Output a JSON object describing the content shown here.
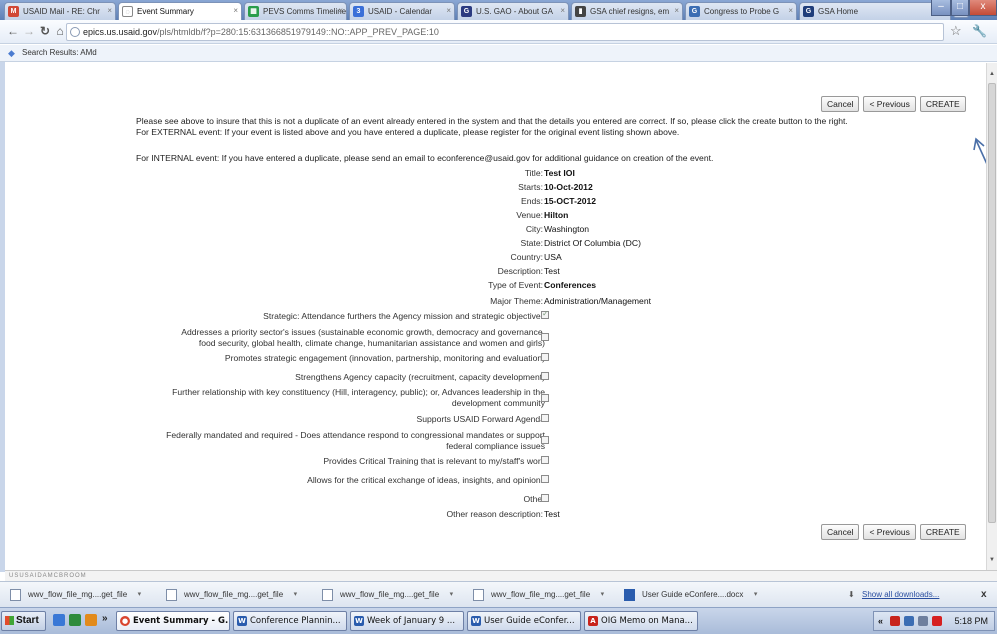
{
  "browser": {
    "tabs": [
      {
        "label": "USAID Mail - RE: Chr",
        "icon": "mail-icon",
        "color": "#d14836"
      },
      {
        "label": "Event Summary",
        "icon": "page-icon",
        "color": "#888888"
      },
      {
        "label": "PEVS Comms Timeline",
        "icon": "sheet-icon",
        "color": "#2a9d4b"
      },
      {
        "label": "USAID - Calendar",
        "icon": "calendar-icon",
        "color": "#3a6fd8"
      },
      {
        "label": "U.S. GAO - About GA",
        "icon": "gao-icon",
        "color": "#2b3a80"
      },
      {
        "label": "GSA chief resigns, em",
        "icon": "news-icon",
        "color": "#444444"
      },
      {
        "label": "Congress to Probe G",
        "icon": "news-icon",
        "color": "#3b6db3"
      },
      {
        "label": "GSA Home",
        "icon": "gsa-icon",
        "color": "#1f3d7a"
      }
    ],
    "window_controls": {
      "minimize": "–",
      "maximize": "□",
      "close": "x"
    },
    "new_tab": "+",
    "address": {
      "host": "epics.us.usaid.gov",
      "path": "/pls/htmldb/f?p=280:15:6313668519791​49::NO::APP_PREV_PAGE:10"
    },
    "bookmark": "Search Results: AMd"
  },
  "page": {
    "buttons": {
      "cancel": "Cancel",
      "previous": "< Previous",
      "create": "CREATE"
    },
    "instructions": [
      "Please see above to insure that this is not a duplicate of an event already entered in the system and that the details you entered are correct. If so, please click the create button to the right.",
      "For EXTERNAL event: If your event is listed above and you have entered a duplicate, please register for the original event listing shown above.",
      "For INTERNAL event: If you have entered a duplicate, please send an email to econference@usaid.gov for additional guidance on creation of the event."
    ],
    "fields": {
      "title": {
        "label": "Title:",
        "value": "Test IOI"
      },
      "starts": {
        "label": "Starts:",
        "value": "10-Oct-2012"
      },
      "ends": {
        "label": "Ends:",
        "value": "15-OCT-2012"
      },
      "venue": {
        "label": "Venue:",
        "value": "Hilton"
      },
      "city": {
        "label": "City:",
        "value": "Washington"
      },
      "state": {
        "label": "State:",
        "value": "District Of Columbia (DC)"
      },
      "country": {
        "label": "Country:",
        "value": "USA"
      },
      "description": {
        "label": "Description:",
        "value": "Test"
      },
      "type": {
        "label": "Type of Event:",
        "value": "Conferences"
      },
      "theme": {
        "label": "Major Theme:",
        "value": "Administration/Management"
      },
      "other_reason": {
        "label": "Other reason description:",
        "value": "Test"
      }
    },
    "criteria": [
      {
        "lines": [
          "Strategic: Attendance furthers the Agency mission and strategic objectives"
        ],
        "checked": true
      },
      {
        "lines": [
          "Addresses a priority sector's issues (sustainable economic growth, democracy and governance,",
          "food security, global health, climate change, humanitarian assistance and women and girls)"
        ],
        "checked": false
      },
      {
        "lines": [
          "Promotes strategic engagement (innovation, partnership, monitoring and evaluation)"
        ],
        "checked": false
      },
      {
        "lines": [
          "Strengthens Agency capacity (recruitment, capacity development)"
        ],
        "checked": false
      },
      {
        "lines": [
          "Further relationship with key constituency (Hill, interagency, public); or, Advances leadership in the",
          "development community"
        ],
        "checked": false
      },
      {
        "lines": [
          "Supports USAID Forward Agenda"
        ],
        "checked": false
      },
      {
        "lines": [
          "Federally mandated and required - Does attendance respond to congressional mandates or support",
          "federal compliance issues"
        ],
        "checked": false
      },
      {
        "lines": [
          "Provides Critical Training that is relevant to my/staff's work"
        ],
        "checked": false
      },
      {
        "lines": [
          "Allows for the critical exchange of ideas, insights, and opinions"
        ],
        "checked": false
      },
      {
        "lines": [
          "Other"
        ],
        "checked": false
      }
    ]
  },
  "status_text": "USUSAIDAMCBROOM",
  "downloads": {
    "items": [
      "wwv_flow_file_mg....get_file",
      "wwv_flow_file_mg....get_file",
      "wwv_flow_file_mg....get_file",
      "wwv_flow_file_mg....get_file",
      "User Guide eConfere....docx"
    ],
    "show_all": "Show all downloads...",
    "close": "x"
  },
  "taskbar": {
    "start": "Start",
    "chevron": "»",
    "buttons": [
      {
        "label": "Event Summary - G...",
        "icon": "chrome-icon",
        "color": "#d9452f",
        "active": true
      },
      {
        "label": "Conference Plannin...",
        "icon": "word-icon",
        "color": "#2a5cad",
        "active": false
      },
      {
        "label": "Week of January 9 ...",
        "icon": "word-icon",
        "color": "#2a5cad",
        "active": false
      },
      {
        "label": "User Guide eConfer...",
        "icon": "word-icon",
        "color": "#2a5cad",
        "active": false
      },
      {
        "label": "OIG Memo on Mana...",
        "icon": "pdf-icon",
        "color": "#c8231b",
        "active": false
      }
    ],
    "tray_chevron": "«",
    "clock": "5:18 PM"
  }
}
